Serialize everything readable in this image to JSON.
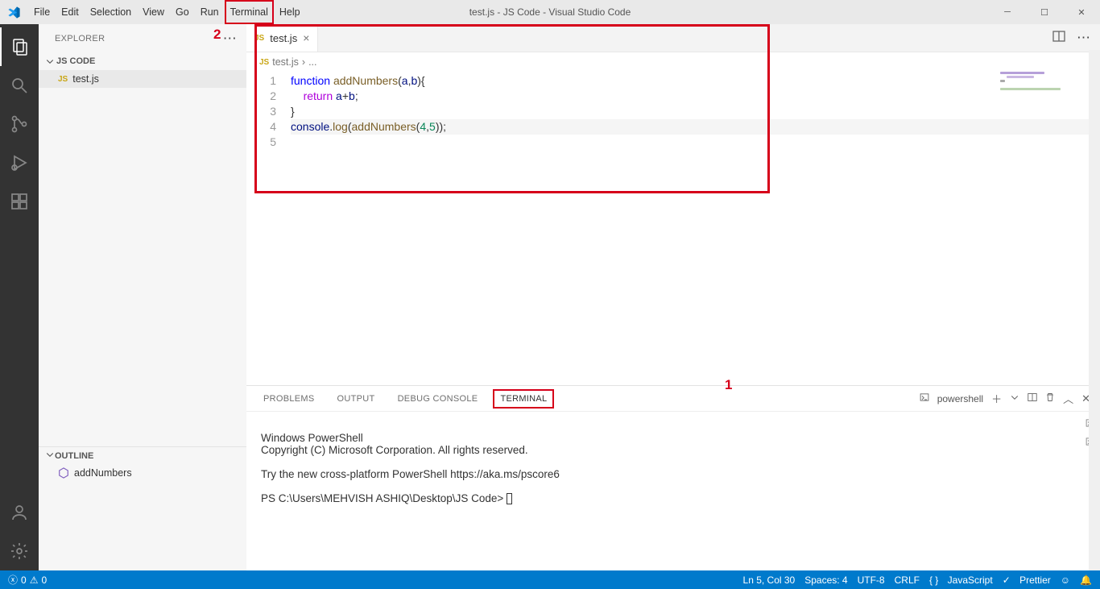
{
  "window": {
    "title": "test.js - JS Code - Visual Studio Code"
  },
  "menu": {
    "items": [
      "File",
      "Edit",
      "Selection",
      "View",
      "Go",
      "Run",
      "Terminal",
      "Help"
    ],
    "highlightedIndex": 6
  },
  "annotations": {
    "a1": "1",
    "a2": "2"
  },
  "sidebar": {
    "title": "EXPLORER",
    "workspace": "JS CODE",
    "files": [
      {
        "icon": "JS",
        "name": "test.js"
      }
    ],
    "outline": {
      "title": "OUTLINE",
      "items": [
        {
          "name": "addNumbers"
        }
      ]
    }
  },
  "tabs": {
    "items": [
      {
        "icon": "JS",
        "name": "test.js"
      }
    ]
  },
  "breadcrumb": {
    "icon": "JS",
    "file": "test.js",
    "sep": "›",
    "rest": "..."
  },
  "code": {
    "lines": [
      {
        "n": "1",
        "tokens": [
          [
            "kw-blue",
            "function"
          ],
          [
            "punct",
            " "
          ],
          [
            "fn-name",
            "addNumbers"
          ],
          [
            "punct",
            "("
          ],
          [
            "ident",
            "a"
          ],
          [
            "punct",
            ","
          ],
          [
            "ident",
            "b"
          ],
          [
            "punct",
            ")"
          ],
          [
            "punct",
            "{"
          ]
        ]
      },
      {
        "n": "2",
        "indent": "    ",
        "tokens": [
          [
            "kw-purple",
            "return"
          ],
          [
            "punct",
            " "
          ],
          [
            "ident",
            "a"
          ],
          [
            "punct",
            "+"
          ],
          [
            "ident",
            "b"
          ],
          [
            "punct",
            ";"
          ]
        ]
      },
      {
        "n": "3",
        "tokens": [
          [
            "punct",
            "}"
          ]
        ]
      },
      {
        "n": "4",
        "tokens": []
      },
      {
        "n": "5",
        "current": true,
        "tokens": [
          [
            "ident",
            "console"
          ],
          [
            "punct",
            "."
          ],
          [
            "fn-name",
            "log"
          ],
          [
            "punct",
            "("
          ],
          [
            "fn-name",
            "addNumbers"
          ],
          [
            "punct",
            "("
          ],
          [
            "num",
            "4"
          ],
          [
            "punct",
            ","
          ],
          [
            "num",
            "5"
          ],
          [
            "punct",
            "))"
          ],
          [
            "punct",
            ";"
          ]
        ]
      }
    ]
  },
  "panel": {
    "tabs": [
      "PROBLEMS",
      "OUTPUT",
      "DEBUG CONSOLE",
      "TERMINAL"
    ],
    "activeIndex": 3,
    "shell_label": "powershell",
    "terminal": [
      "",
      "Windows PowerShell",
      "Copyright (C) Microsoft Corporation. All rights reserved.",
      "",
      "Try the new cross-platform PowerShell https://aka.ms/pscore6",
      "",
      "PS C:\\Users\\MEHVISH ASHIQ\\Desktop\\JS Code> "
    ]
  },
  "status": {
    "errors": "0",
    "warnings": "0",
    "cursor": "Ln 5, Col 30",
    "spaces": "Spaces: 4",
    "encoding": "UTF-8",
    "eol": "CRLF",
    "lang": "JavaScript",
    "prettier": "Prettier"
  }
}
